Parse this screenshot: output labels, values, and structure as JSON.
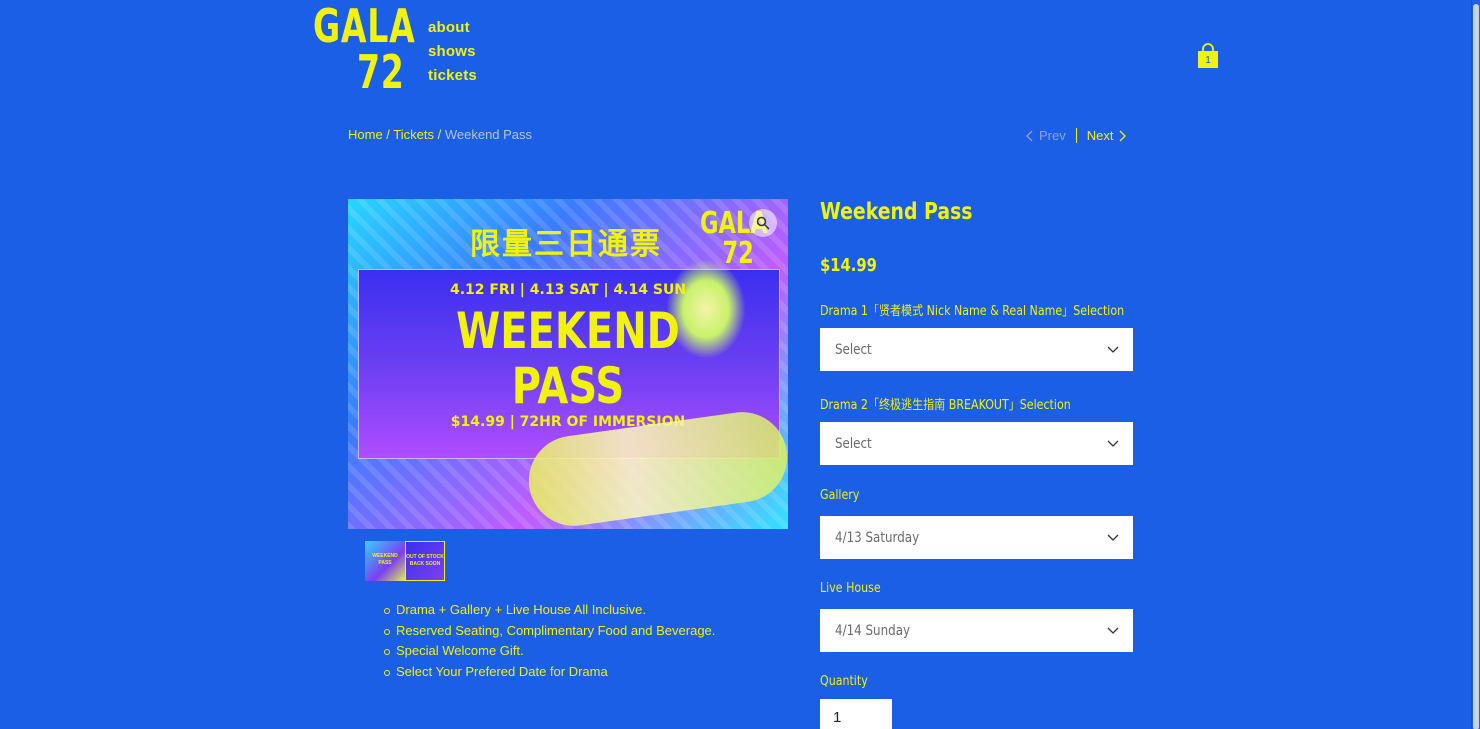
{
  "brand": {
    "logo_line1": "GALA",
    "logo_line2": "72"
  },
  "nav": {
    "items": [
      "about",
      "shows",
      "tickets"
    ]
  },
  "cart": {
    "count": "1",
    "icon": "shopping-bag-icon"
  },
  "breadcrumb": {
    "home": "Home",
    "sep1": " / ",
    "tickets": "Tickets",
    "sep2": " / ",
    "current": "Weekend Pass"
  },
  "pager": {
    "prev": "Prev",
    "next": "Next"
  },
  "product_image": {
    "chinese_title": "限量三日通票",
    "corner_text": "GALA",
    "corner_text2": "72",
    "dates": "4.12 FRI  |  4.13 SAT  |  4.14 SUN",
    "headline1": "WEEKEND",
    "headline2": "PASS",
    "price_line": "$14.99  |  72HR OF IMMERSION"
  },
  "thumbnails": [
    {
      "text": "WEEKEND PASS"
    },
    {
      "text": "OUT OF STOCK BACK SOON"
    }
  ],
  "features": [
    "Drama + Gallery + Live House All Inclusive.",
    "Reserved Seating, Complimentary Food and Beverage.",
    "Special Welcome Gift.",
    "Select Your Prefered Date for Drama"
  ],
  "product": {
    "title": "Weekend Pass",
    "price": "$14.99"
  },
  "options": [
    {
      "label": "Drama 1「贤者模式 Nick Name & Real Name」Selection",
      "value": "Select"
    },
    {
      "label": "Drama 2「终极逃生指南 BREAKOUT」Selection",
      "value": "Select"
    },
    {
      "label": "Gallery",
      "value": "4/13 Saturday"
    },
    {
      "label": "Live House",
      "value": "4/14 Sunday"
    }
  ],
  "quantity": {
    "label": "Quantity",
    "value": "1"
  },
  "colors": {
    "background": "#1a5fe6",
    "accent": "#f2f20f"
  }
}
